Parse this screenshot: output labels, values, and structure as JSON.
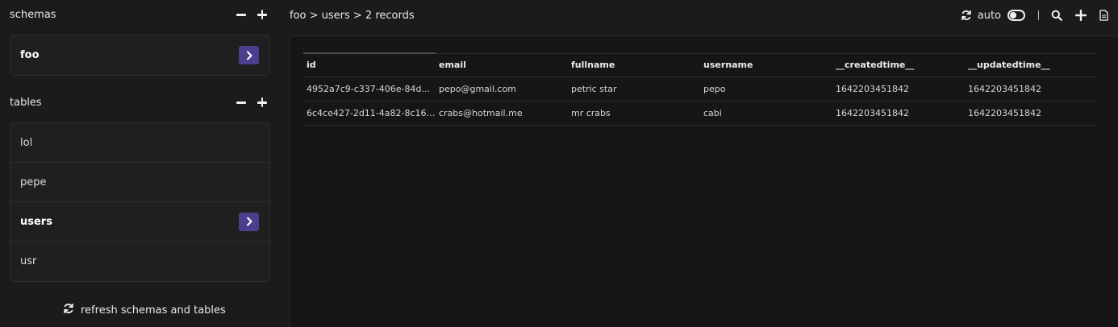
{
  "sidebar": {
    "schemas": {
      "title": "schemas",
      "items": [
        {
          "label": "foo",
          "active": true
        }
      ]
    },
    "tables": {
      "title": "tables",
      "items": [
        {
          "label": "lol",
          "active": false
        },
        {
          "label": "pepe",
          "active": false
        },
        {
          "label": "users",
          "active": true
        },
        {
          "label": "usr",
          "active": false
        }
      ]
    },
    "refresh_label": "refresh schemas and tables"
  },
  "header": {
    "breadcrumb": "foo > users > 2 records",
    "auto_label": "auto",
    "auto_enabled": false
  },
  "table": {
    "columns": [
      "id",
      "email",
      "fullname",
      "username",
      "__createdtime__",
      "__updatedtime__"
    ],
    "rows": [
      [
        "4952a7c9-c337-406e-84d...",
        "pepo@gmail.com",
        "petric star",
        "pepo",
        "1642203451842",
        "1642203451842"
      ],
      [
        "6c4ce427-2d11-4a82-8c16-...",
        "crabs@hotmail.me",
        "mr crabs",
        "cabi",
        "1642203451842",
        "1642203451842"
      ]
    ]
  },
  "colors": {
    "accent": "#4a3f8c",
    "background": "#1b1b1b",
    "panel": "#161616"
  }
}
